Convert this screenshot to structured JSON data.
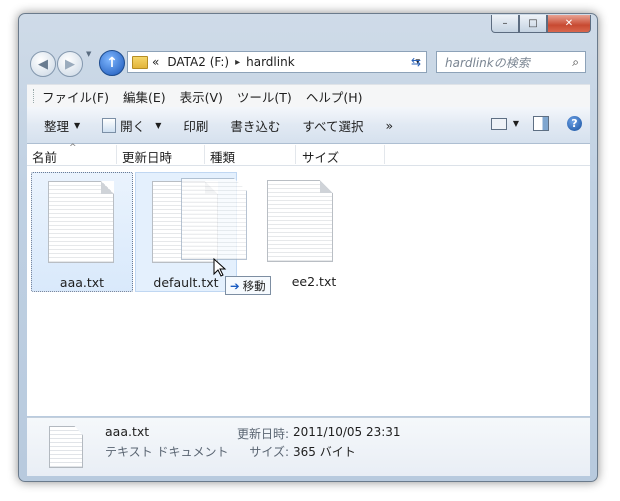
{
  "window": {
    "caption_buttons": {
      "minimize": "–",
      "maximize": "□",
      "close": "✕"
    }
  },
  "address_bar": {
    "overflow": "«",
    "drive": "DATA2 (F:)",
    "folder": "hardlink",
    "separator": "▸",
    "dropdown": "▾"
  },
  "search": {
    "placeholder": "hardlinkの検索",
    "icon": "search-icon"
  },
  "menu": [
    "ファイル(F)",
    "編集(E)",
    "表示(V)",
    "ツール(T)",
    "ヘルプ(H)"
  ],
  "toolbar": {
    "organize": "整理",
    "open": "開く",
    "print": "印刷",
    "burn": "書き込む",
    "select_all": "すべて選択",
    "more": "»"
  },
  "columns": [
    "名前",
    "更新日時",
    "種類",
    "サイズ"
  ],
  "files": [
    {
      "name": "aaa.txt"
    },
    {
      "name": "default.txt"
    },
    {
      "name": "ee2.txt"
    }
  ],
  "drag_tip": {
    "arrow": "➔",
    "label": "移動"
  },
  "details": {
    "name": "aaa.txt",
    "type": "テキスト ドキュメント",
    "modified_label": "更新日時:",
    "modified_value": "2011/10/05 23:31",
    "size_label": "サイズ:",
    "size_value": "365 バイト"
  },
  "colors": {
    "accent": "#1a56b8",
    "selection": "#d9e9fb"
  }
}
